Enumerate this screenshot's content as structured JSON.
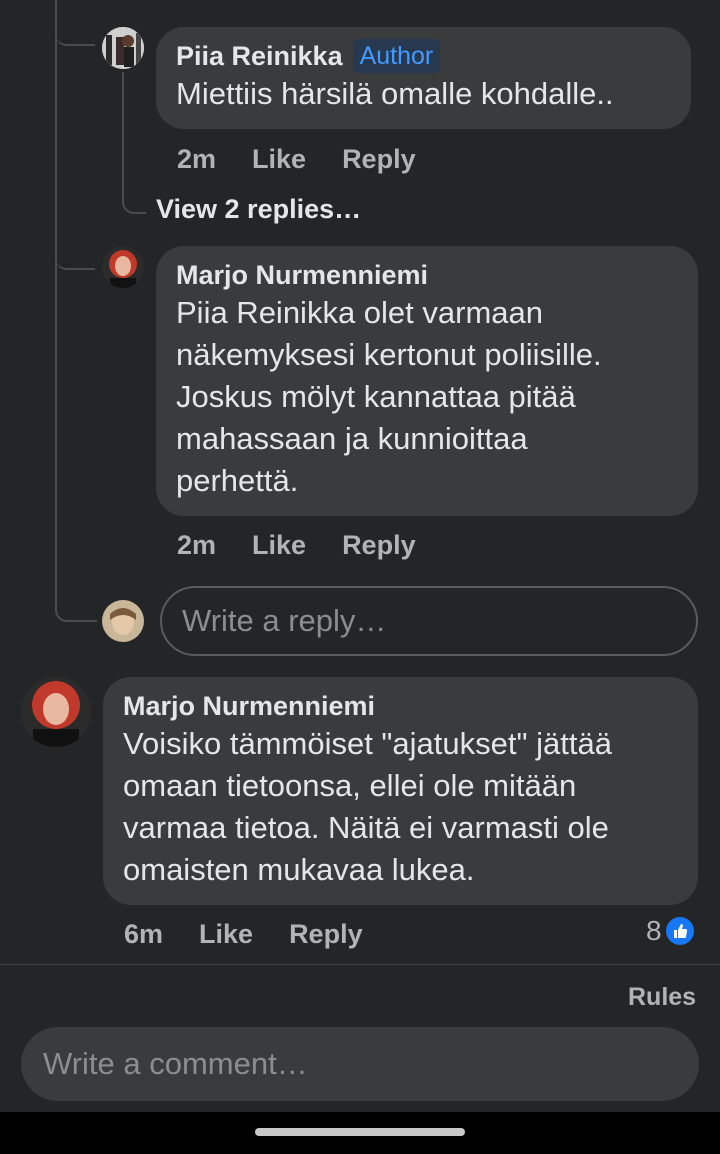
{
  "comments": [
    {
      "author": "Piia Reinikka",
      "badge": "Author",
      "text": "Miettiis härsilä omalle kohdalle..",
      "time": "2m",
      "like": "Like",
      "reply": "Reply",
      "view_replies": "View 2 replies…"
    },
    {
      "author": "Marjo Nurmenniemi",
      "text_lines": [
        "Piia Reinikka olet varmaan",
        "näkemyksesi kertonut poliisille.",
        "Joskus mölyt kannattaa pitää",
        "mahassaan ja kunnioittaa",
        "perhettä."
      ],
      "time": "2m",
      "like": "Like",
      "reply": "Reply"
    }
  ],
  "reply_input": {
    "placeholder": "Write a reply…"
  },
  "main_comment": {
    "author": "Marjo Nurmenniemi",
    "text_lines": [
      "Voisiko tämmöiset \"ajatukset\" jättää",
      "omaan tietoonsa, ellei ole mitään",
      "varmaa tietoa. Näitä ei varmasti ole",
      "omaisten mukavaa lukea."
    ],
    "time": "6m",
    "like": "Like",
    "reply": "Reply",
    "reaction_count": "8",
    "reaction_icon": "like-thumb-icon",
    "reaction_color": "#1877f2"
  },
  "footer": {
    "rules": "Rules",
    "comment_placeholder": "Write a comment…"
  }
}
